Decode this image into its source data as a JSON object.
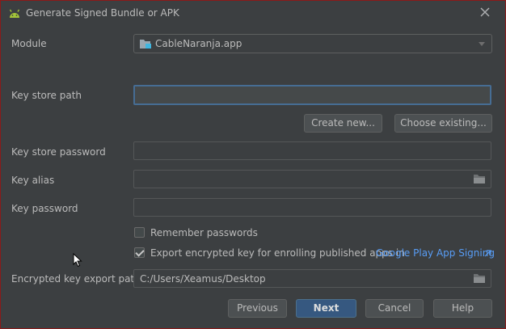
{
  "window": {
    "title": "Generate Signed Bundle or APK",
    "accent": "#a4c639"
  },
  "module": {
    "label": "Module",
    "selected": "CableNaranja.app"
  },
  "key_store_path": {
    "label": "Key store path",
    "value": ""
  },
  "buttons": {
    "create_new": "Create new...",
    "choose_existing": "Choose existing...",
    "previous": "Previous",
    "next": "Next",
    "cancel": "Cancel",
    "help": "Help"
  },
  "key_store_password": {
    "label": "Key store password",
    "value": ""
  },
  "key_alias": {
    "label": "Key alias",
    "value": ""
  },
  "key_password": {
    "label": "Key password",
    "value": ""
  },
  "remember_passwords": {
    "label": "Remember passwords",
    "checked": false
  },
  "export_key": {
    "label": "Export encrypted key for enrolling published apps in",
    "link": "Google Play App Signing",
    "link_icon": "external-link-arrow",
    "checked": true
  },
  "export_path": {
    "label": "Encrypted key export path",
    "value": "C:/Users/Xeamus/Desktop"
  },
  "icons": {
    "title": "android-icon",
    "module": "module-folder-icon",
    "browse": "folder-icon",
    "close": "close-icon"
  },
  "colors": {
    "background": "#3c3f41",
    "primary_button": "#365880",
    "link": "#589df6",
    "focus_border": "#466d94"
  }
}
